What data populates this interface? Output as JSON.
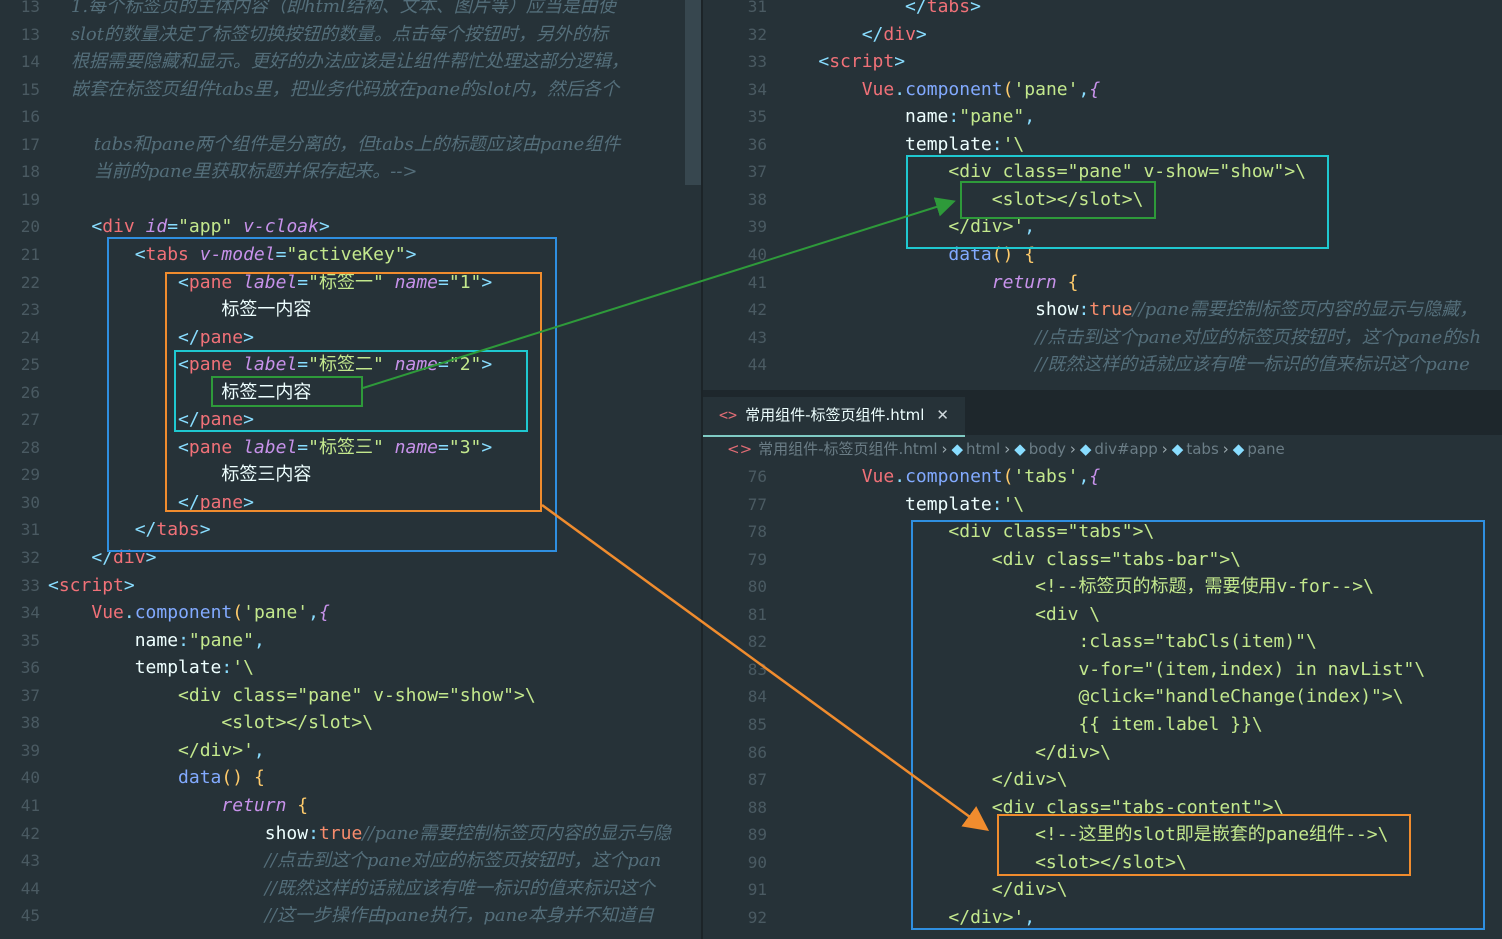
{
  "left_pane": {
    "lines": [
      {
        "n": "13",
        "html": "<span class='cm'>    1.每个标签页的主体内容（即html结构、文本、图片等）应当是由使</span>"
      },
      {
        "n": "13",
        "html": "<span class='cm'>    slot的数量决定了标签切换按钮的数量。点击每个按钮时，另外的标</span>"
      },
      {
        "n": "14",
        "html": "<span class='cm'>    根据需要隐藏和显示。更好的办法应该是让组件帮忙处理这部分逻辑，</span>"
      },
      {
        "n": "15",
        "html": "<span class='cm'>    嵌套在标签页组件tabs里，把业务代码放在pane的slot内，然后各个</span>"
      },
      {
        "n": "16",
        "html": ""
      },
      {
        "n": "17",
        "html": "<span class='cm'>        tabs和pane两个组件是分离的，但tabs上的标题应该由pane组件</span>"
      },
      {
        "n": "18",
        "html": "<span class='cm'>        当前的pane里获取标题并保存起来。--></span>"
      },
      {
        "n": "19",
        "html": ""
      },
      {
        "n": "20",
        "html": "    <span class='t'>&lt;</span><span class='tag'>div</span> <span class='at'>id</span><span class='t'>=</span><span class='st'>\"app\"</span> <span class='at'>v-cloak</span><span class='t'>&gt;</span>"
      },
      {
        "n": "21",
        "html": "        <span class='t'>&lt;</span><span class='tag'>tabs</span> <span class='at'>v-model</span><span class='t'>=</span><span class='st'>\"activeKey\"</span><span class='t'>&gt;</span>"
      },
      {
        "n": "22",
        "html": "            <span class='t'>&lt;</span><span class='tag'>pane</span> <span class='at'>label</span><span class='t'>=</span><span class='st'>\"标签一\"</span> <span class='at'>name</span><span class='t'>=</span><span class='st'>\"1\"</span><span class='t'>&gt;</span>"
      },
      {
        "n": "23",
        "html": "                标签一内容"
      },
      {
        "n": "24",
        "html": "            <span class='t'>&lt;/</span><span class='tag'>pane</span><span class='t'>&gt;</span>"
      },
      {
        "n": "25",
        "html": "            <span class='t'>&lt;</span><span class='tag'>pane</span> <span class='at'>label</span><span class='t'>=</span><span class='st'>\"标签二\"</span> <span class='at'>name</span><span class='t'>=</span><span class='st'>\"2\"</span><span class='t'>&gt;</span>"
      },
      {
        "n": "26",
        "html": "                标签二内容"
      },
      {
        "n": "27",
        "html": "            <span class='t'>&lt;/</span><span class='tag'>pane</span><span class='t'>&gt;</span>"
      },
      {
        "n": "28",
        "html": "            <span class='t'>&lt;</span><span class='tag'>pane</span> <span class='at'>label</span><span class='t'>=</span><span class='st'>\"标签三\"</span> <span class='at'>name</span><span class='t'>=</span><span class='st'>\"3\"</span><span class='t'>&gt;</span>"
      },
      {
        "n": "29",
        "html": "                标签三内容"
      },
      {
        "n": "30",
        "html": "            <span class='t'>&lt;/</span><span class='tag'>pane</span><span class='t'>&gt;</span>"
      },
      {
        "n": "31",
        "html": "        <span class='t'>&lt;/</span><span class='tag'>tabs</span><span class='t'>&gt;</span>"
      },
      {
        "n": "32",
        "html": "    <span class='t'>&lt;/</span><span class='tag'>div</span><span class='t'>&gt;</span>"
      },
      {
        "n": "33",
        "html": "<span class='t'>&lt;</span><span class='tag'>script</span><span class='t'>&gt;</span>"
      },
      {
        "n": "34",
        "html": "    <span class='tag'>Vue</span><span class='t'>.</span><span class='fn'>component</span><span class='ob'>(</span><span class='val'>'pane'</span><span class='t'>,</span><span class='kw'>{</span>"
      },
      {
        "n": "35",
        "html": "        <span class='pl'>name</span><span class='t'>:</span><span class='val'>\"pane\"</span><span class='t'>,</span>"
      },
      {
        "n": "36",
        "html": "        <span class='pl'>template</span><span class='t'>:</span><span class='val'>'\\</span>"
      },
      {
        "n": "37",
        "html": "            <span class='val'>&lt;div class=\"pane\" v-show=\"show\"&gt;\\</span>"
      },
      {
        "n": "38",
        "html": "                <span class='val'>&lt;slot&gt;&lt;/slot&gt;\\</span>"
      },
      {
        "n": "39",
        "html": "            <span class='val'>&lt;/div&gt;'</span><span class='t'>,</span>"
      },
      {
        "n": "40",
        "html": "            <span class='fn'>data</span><span class='ob'>()</span> <span class='ob'>{</span>"
      },
      {
        "n": "41",
        "html": "                <span class='kw'>return</span> <span class='ob'>{</span>"
      },
      {
        "n": "42",
        "html": "                    <span class='pl'>show</span><span class='t'>:</span><span class='or'>true</span><span class='cm'>//pane需要控制标签页内容的显示与隐</span>"
      },
      {
        "n": "43",
        "html": "                    <span class='cm'>//点击到这个pane对应的标签页按钮时，这个pan</span>"
      },
      {
        "n": "44",
        "html": "                    <span class='cm'>//既然这样的话就应该有唯一标识的值来标识这个</span>"
      },
      {
        "n": "45",
        "html": "                    <span class='cm'>//这一步操作由pane执行，pane本身并不知道自</span>"
      }
    ]
  },
  "right_top_pane": {
    "lines": [
      {
        "n": "31",
        "html": "            <span class='t'>&lt;/</span><span class='tag'>tabs</span><span class='t'>&gt;</span>"
      },
      {
        "n": "32",
        "html": "        <span class='t'>&lt;/</span><span class='tag'>div</span><span class='t'>&gt;</span>"
      },
      {
        "n": "33",
        "html": "    <span class='t'>&lt;</span><span class='tag'>script</span><span class='t'>&gt;</span>"
      },
      {
        "n": "34",
        "html": "        <span class='tag'>Vue</span><span class='t'>.</span><span class='fn'>component</span><span class='ob'>(</span><span class='val'>'pane'</span><span class='t'>,</span><span class='kw'>{</span>"
      },
      {
        "n": "35",
        "html": "            <span class='pl'>name</span><span class='t'>:</span><span class='val'>\"pane\"</span><span class='t'>,</span>"
      },
      {
        "n": "36",
        "html": "            <span class='pl'>template</span><span class='t'>:</span><span class='val'>'\\</span>"
      },
      {
        "n": "37",
        "html": "                <span class='val'>&lt;div class=\"pane\" v-show=\"show\"&gt;\\</span>"
      },
      {
        "n": "38",
        "html": "                    <span class='val'>&lt;slot&gt;&lt;/slot&gt;\\</span>"
      },
      {
        "n": "39",
        "html": "                <span class='val'>&lt;/div&gt;'</span><span class='t'>,</span>"
      },
      {
        "n": "40",
        "html": "                <span class='fn'>data</span><span class='ob'>()</span> <span class='ob'>{</span>"
      },
      {
        "n": "41",
        "html": "                    <span class='kw'>return</span> <span class='ob'>{</span>"
      },
      {
        "n": "42",
        "html": "                        <span class='pl'>show</span><span class='t'>:</span><span class='or'>true</span><span class='cm'>//pane需要控制标签页内容的显示与隐藏，</span>"
      },
      {
        "n": "43",
        "html": "                        <span class='cm'>//点击到这个pane对应的标签页按钮时，这个pane的sh</span>"
      },
      {
        "n": "44",
        "html": "                        <span class='cm'>//既然这样的话就应该有唯一标识的值来标识这个pane</span>"
      }
    ]
  },
  "tab": {
    "label": "常用组件-标签页组件.html",
    "close": "✕",
    "icon": "<>"
  },
  "breadcrumb": {
    "file": "常用组件-标签页组件.html",
    "items": [
      "html",
      "body",
      "div#app",
      "tabs",
      "pane"
    ]
  },
  "right_bottom_pane": {
    "lines": [
      {
        "n": "76",
        "html": "        <span class='tag'>Vue</span><span class='t'>.</span><span class='fn'>component</span><span class='ob'>(</span><span class='val'>'tabs'</span><span class='t'>,</span><span class='kw'>{</span>"
      },
      {
        "n": "77",
        "html": "            <span class='pl'>template</span><span class='t'>:</span><span class='val'>'\\</span>"
      },
      {
        "n": "78",
        "html": "                <span class='val'>&lt;div class=\"tabs\"&gt;\\</span>"
      },
      {
        "n": "79",
        "html": "                    <span class='val'>&lt;div class=\"tabs-bar\"&gt;\\</span>"
      },
      {
        "n": "80",
        "html": "                        <span class='val'>&lt;!--标签页的标题，需要使用v-for--&gt;\\</span>"
      },
      {
        "n": "81",
        "html": "                        <span class='val'>&lt;div \\</span>"
      },
      {
        "n": "82",
        "html": "                            <span class='val'>:class=\"tabCls(item)\"\\</span>"
      },
      {
        "n": "83",
        "html": "                            <span class='val'>v-for=\"(item,index) in navList\"\\</span>"
      },
      {
        "n": "84",
        "html": "                            <span class='val'>@click=\"handleChange(index)\"&gt;\\</span>"
      },
      {
        "n": "85",
        "html": "                            <span class='val'>{{ item.label }}\\</span>"
      },
      {
        "n": "86",
        "html": "                        <span class='val'>&lt;/div&gt;\\</span>"
      },
      {
        "n": "87",
        "html": "                    <span class='val'>&lt;/div&gt;\\</span>"
      },
      {
        "n": "88",
        "html": "                    <span class='val'>&lt;div class=\"tabs-content\"&gt;\\</span>"
      },
      {
        "n": "89",
        "html": "                        <span class='val'>&lt;!--这里的slot即是嵌套的pane组件--&gt;\\</span>"
      },
      {
        "n": "90",
        "html": "                        <span class='val'>&lt;slot&gt;&lt;/slot&gt;\\</span>"
      },
      {
        "n": "91",
        "html": "                    <span class='val'>&lt;/div&gt;\\</span>"
      },
      {
        "n": "92",
        "html": "                <span class='val'>&lt;/div&gt;'</span><span class='t'>,</span>"
      }
    ]
  },
  "colors": {
    "background": "#263238",
    "blue_box": "#2f8fe0",
    "orange_box": "#f08c2e",
    "teal_box": "#1fc8d0",
    "green_box": "#2e9a3a"
  }
}
